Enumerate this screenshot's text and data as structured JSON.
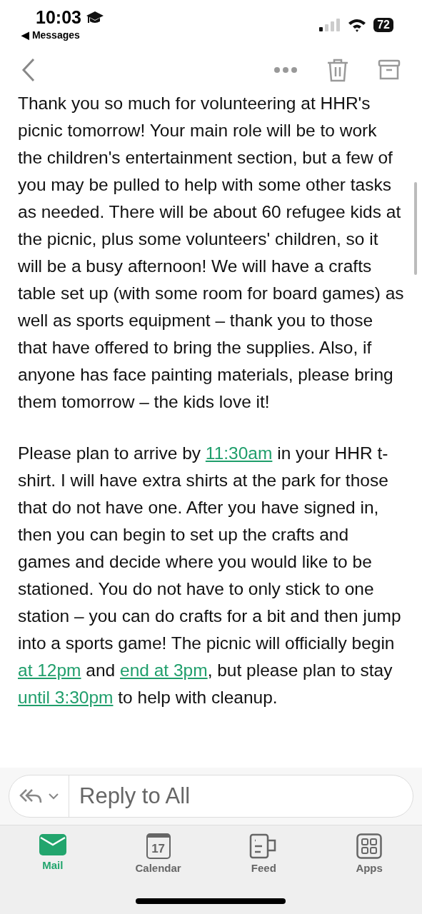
{
  "status_bar": {
    "time": "10:03",
    "back_label": "◀ Messages",
    "battery": "72"
  },
  "paragraphs": [
    {
      "segments": [
        {
          "kind": "text",
          "text": "Thank you so much for volunteering at HHR's picnic tomorrow! Your main role will be to work the children's entertainment section, but a few of you may be pulled to help with some other tasks as needed. There will be about 60 refugee kids at the picnic, plus some volunteers' children, so it will be a busy afternoon! We will have a crafts table set up (with some room for board games) as well as sports equipment – thank you to those that have offered to bring the supplies. Also, if anyone has face painting materials, please bring them tomorrow – the kids love it!"
        }
      ]
    },
    {
      "segments": [
        {
          "kind": "text",
          "text": "Please plan to arrive by "
        },
        {
          "kind": "link",
          "text": "11:30am"
        },
        {
          "kind": "text",
          "text": " in your HHR t-shirt. I will have extra shirts at the park for those that do not have one. After you have signed in, then you can begin to set up the crafts and games and decide where you would like to be stationed. You do not have to only stick to one station – you can do crafts for a bit and then jump into a sports game! The picnic will officially begin "
        },
        {
          "kind": "link",
          "text": "at 12pm"
        },
        {
          "kind": "text",
          "text": " and "
        },
        {
          "kind": "link",
          "text": "end at 3pm"
        },
        {
          "kind": "text",
          "text": ", but please plan to stay "
        },
        {
          "kind": "link",
          "text": "until 3:30pm"
        },
        {
          "kind": "text",
          "text": " to help with cleanup."
        }
      ]
    }
  ],
  "reply": {
    "placeholder": "Reply to All"
  },
  "tabs": [
    {
      "kind": "mail",
      "label": "Mail",
      "selected": true
    },
    {
      "kind": "calendar",
      "label": "Calendar",
      "selected": false,
      "day": "17"
    },
    {
      "kind": "feed",
      "label": "Feed",
      "selected": false
    },
    {
      "kind": "apps",
      "label": "Apps",
      "selected": false
    }
  ]
}
